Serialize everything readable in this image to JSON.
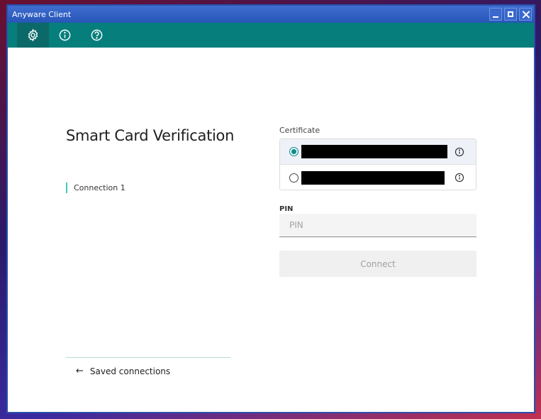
{
  "window": {
    "title": "Anyware Client"
  },
  "toolbar": {
    "items": [
      {
        "icon": "gear-icon",
        "active": true
      },
      {
        "icon": "info-icon",
        "active": false
      },
      {
        "icon": "help-icon",
        "active": false
      }
    ]
  },
  "page": {
    "heading": "Smart Card Verification",
    "connection_label": "Connection 1",
    "saved_connections_label": "Saved connections"
  },
  "certificate": {
    "label": "Certificate",
    "options": [
      {
        "selected": true,
        "redacted": true
      },
      {
        "selected": false,
        "redacted": true
      }
    ]
  },
  "pin": {
    "label": "PIN",
    "placeholder": "PIN",
    "value": ""
  },
  "connect_button": {
    "label": "Connect",
    "enabled": false
  },
  "colors": {
    "toolbar": "#067e7c",
    "accent": "#0a8f8b",
    "titlebar": "#2756b8"
  }
}
